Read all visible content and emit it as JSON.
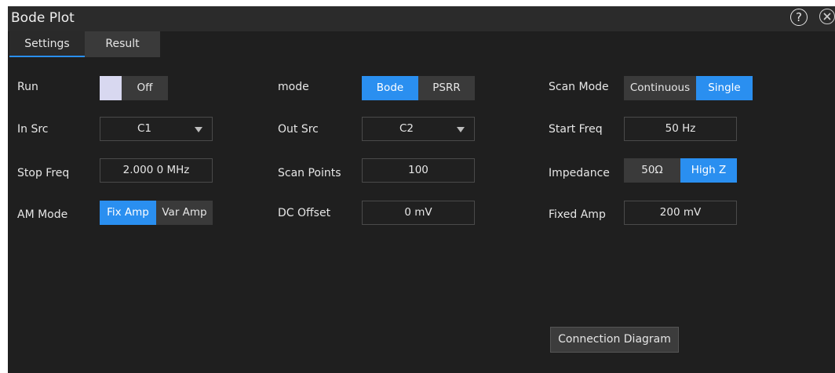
{
  "window": {
    "title": "Bode Plot",
    "help_glyph": "?",
    "close_icon": "close-icon"
  },
  "tabs": [
    {
      "label": "Settings",
      "active": true
    },
    {
      "label": "Result",
      "active": false
    }
  ],
  "col1": {
    "run_label": "Run",
    "run_value": "Off",
    "insrc_label": "In Src",
    "insrc_value": "C1",
    "stopfreq_label": "Stop Freq",
    "stopfreq_value": "2.000 0 MHz",
    "ammode_label": "AM Mode",
    "ammode_options": [
      "Fix Amp",
      "Var Amp"
    ],
    "ammode_selected": "Fix Amp"
  },
  "col2": {
    "mode_label": "mode",
    "mode_options": [
      "Bode",
      "PSRR"
    ],
    "mode_selected": "Bode",
    "outsrc_label": "Out Src",
    "outsrc_value": "C2",
    "scanpoints_label": "Scan Points",
    "scanpoints_value": "100",
    "dcoffset_label": "DC Offset",
    "dcoffset_value": "0 mV"
  },
  "col3": {
    "scanmode_label": "Scan Mode",
    "scanmode_options": [
      "Continuous",
      "Single"
    ],
    "scanmode_selected": "Single",
    "startfreq_label": "Start Freq",
    "startfreq_value": "50 Hz",
    "impedance_label": "Impedance",
    "impedance_options": [
      "50Ω",
      "High Z"
    ],
    "impedance_selected": "High Z",
    "fixedamp_label": "Fixed Amp",
    "fixedamp_value": "200 mV"
  },
  "connection_button": "Connection Diagram",
  "colors": {
    "accent": "#2a8ff0",
    "panel": "#1f1f1f",
    "titlebar": "#2b2b2b"
  }
}
